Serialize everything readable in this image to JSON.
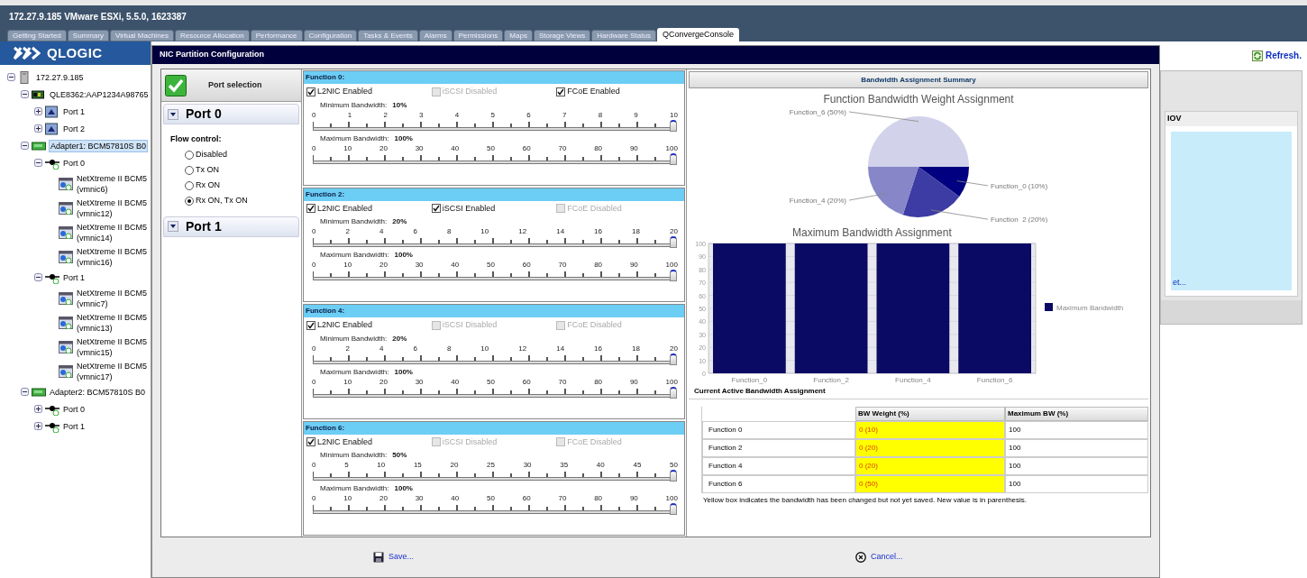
{
  "browser_title": "172.27.9.185 VMware ESXi, 5.5.0, 1623387",
  "tabs": [
    {
      "label": "Getting Started",
      "selected": false
    },
    {
      "label": "Summary",
      "selected": false
    },
    {
      "label": "Virtual Machines",
      "selected": false
    },
    {
      "label": "Resource Allocation",
      "selected": false
    },
    {
      "label": "Performance",
      "selected": false
    },
    {
      "label": "Configuration",
      "selected": false
    },
    {
      "label": "Tasks & Events",
      "selected": false
    },
    {
      "label": "Alarms",
      "selected": false
    },
    {
      "label": "Permissions",
      "selected": false
    },
    {
      "label": "Maps",
      "selected": false
    },
    {
      "label": "Storage Views",
      "selected": false
    },
    {
      "label": "Hardware Status",
      "selected": false
    },
    {
      "label": "QConvergeConsole",
      "selected": true
    }
  ],
  "logo": "QLOGIC",
  "tree": [
    {
      "label": "172.27.9.185",
      "kind": "host",
      "expanded": true,
      "selected": false,
      "children": [
        {
          "label": "QLE8362:AAP1234A98765",
          "kind": "hba",
          "expanded": true,
          "selected": false,
          "children": [
            {
              "label": "Port 1",
              "kind": "port",
              "expanded": false,
              "selected": false
            },
            {
              "label": "Port 2",
              "kind": "port",
              "expanded": false,
              "selected": false
            }
          ]
        },
        {
          "label": "Adapter1: BCM57810S B0",
          "kind": "adapter",
          "expanded": true,
          "selected": true,
          "children": [
            {
              "label": "Port 0",
              "kind": "connector",
              "expanded": true,
              "selected": false,
              "children": [
                {
                  "label": "NetXtreme II BCM5",
                  "detail": "(vmnic6)",
                  "kind": "nic",
                  "selected": false
                },
                {
                  "label": "NetXtreme II BCM5",
                  "detail": "(vmnic12)",
                  "kind": "nic",
                  "selected": false
                },
                {
                  "label": "NetXtreme II BCM5",
                  "detail": "(vmnic14)",
                  "kind": "nic",
                  "selected": false
                },
                {
                  "label": "NetXtreme II BCM5",
                  "detail": "(vmnic16)",
                  "kind": "nic",
                  "selected": false
                }
              ]
            },
            {
              "label": "Port 1",
              "kind": "connector",
              "expanded": true,
              "selected": false,
              "children": [
                {
                  "label": "NetXtreme II BCM5",
                  "detail": "(vmnic7)",
                  "kind": "nic",
                  "selected": false
                },
                {
                  "label": "NetXtreme II BCM5",
                  "detail": "(vmnic13)",
                  "kind": "nic",
                  "selected": false
                },
                {
                  "label": "NetXtreme II BCM5",
                  "detail": "(vmnic15)",
                  "kind": "nic",
                  "selected": false
                },
                {
                  "label": "NetXtreme II BCM5",
                  "detail": "(vmnic17)",
                  "kind": "nic",
                  "selected": false
                }
              ]
            }
          ]
        },
        {
          "label": "Adapter2: BCM57810S B0",
          "kind": "adapter",
          "expanded": true,
          "selected": false,
          "children": [
            {
              "label": "Port 0",
              "kind": "connector",
              "expanded": false,
              "selected": false
            },
            {
              "label": "Port 1",
              "kind": "connector",
              "expanded": false,
              "selected": false
            }
          ]
        }
      ]
    }
  ],
  "background_panel": {
    "refresh": "Refresh.",
    "header": "IOV",
    "link": "et..."
  },
  "dialog": {
    "title": "NIC Partition Configuration",
    "port_selection": {
      "title": "Port selection",
      "ports": [
        {
          "label": "Port 0",
          "flow_control": {
            "label": "Flow control:",
            "options": [
              {
                "label": "Disabled",
                "selected": false
              },
              {
                "label": "Tx ON",
                "selected": false
              },
              {
                "label": "Rx ON",
                "selected": false
              },
              {
                "label": "Rx ON, Tx ON",
                "selected": true
              }
            ]
          }
        },
        {
          "label": "Port 1"
        }
      ]
    },
    "functions": [
      {
        "title": "Function 0:",
        "options": [
          {
            "label": "L2NIC Enabled",
            "checked": true,
            "disabled": false
          },
          {
            "label": "iSCSI Disabled",
            "checked": false,
            "disabled": true
          },
          {
            "label": "FCoE Enabled",
            "checked": true,
            "disabled": false
          }
        ],
        "sliders": [
          {
            "label": "Minimum Bandwidth:",
            "value": "10%",
            "scale": [
              "0",
              "1",
              "2",
              "3",
              "4",
              "5",
              "6",
              "7",
              "8",
              "9",
              "10"
            ],
            "level": 1
          },
          {
            "label": "Maximum Bandwidth:",
            "value": "100%",
            "scale": [
              "0",
              "10",
              "20",
              "30",
              "40",
              "50",
              "60",
              "70",
              "80",
              "90",
              "100"
            ],
            "level": 1
          }
        ]
      },
      {
        "title": "Function 2:",
        "options": [
          {
            "label": "L2NIC Enabled",
            "checked": true,
            "disabled": false
          },
          {
            "label": "iSCSI Enabled",
            "checked": true,
            "disabled": false
          },
          {
            "label": "FCoE Disabled",
            "checked": false,
            "disabled": true
          }
        ],
        "sliders": [
          {
            "label": "Minimum Bandwidth:",
            "value": "20%",
            "scale": [
              "0",
              "2",
              "4",
              "6",
              "8",
              "10",
              "12",
              "14",
              "16",
              "18",
              "20"
            ],
            "level": 1
          },
          {
            "label": "Maximum Bandwidth:",
            "value": "100%",
            "scale": [
              "0",
              "10",
              "20",
              "30",
              "40",
              "50",
              "60",
              "70",
              "80",
              "90",
              "100"
            ],
            "level": 1
          }
        ]
      },
      {
        "title": "Function 4:",
        "options": [
          {
            "label": "L2NIC Enabled",
            "checked": true,
            "disabled": false
          },
          {
            "label": "iSCSI Disabled",
            "checked": false,
            "disabled": true
          },
          {
            "label": "FCoE Disabled",
            "checked": false,
            "disabled": true
          }
        ],
        "sliders": [
          {
            "label": "Minimum Bandwidth:",
            "value": "20%",
            "scale": [
              "0",
              "2",
              "4",
              "6",
              "8",
              "10",
              "12",
              "14",
              "16",
              "18",
              "20"
            ],
            "level": 1
          },
          {
            "label": "Maximum Bandwidth:",
            "value": "100%",
            "scale": [
              "0",
              "10",
              "20",
              "30",
              "40",
              "50",
              "60",
              "70",
              "80",
              "90",
              "100"
            ],
            "level": 1
          }
        ]
      },
      {
        "title": "Function 6:",
        "options": [
          {
            "label": "L2NIC Enabled",
            "checked": true,
            "disabled": false
          },
          {
            "label": "iSCSI Disabled",
            "checked": false,
            "disabled": true
          },
          {
            "label": "FCoE Disabled",
            "checked": false,
            "disabled": true
          }
        ],
        "sliders": [
          {
            "label": "Minimum Bandwidth:",
            "value": "50%",
            "scale": [
              "0",
              "5",
              "10",
              "15",
              "20",
              "25",
              "30",
              "35",
              "40",
              "45",
              "50"
            ],
            "level": 1
          },
          {
            "label": "Maximum Bandwidth:",
            "value": "100%",
            "scale": [
              "0",
              "10",
              "20",
              "30",
              "40",
              "50",
              "60",
              "70",
              "80",
              "90",
              "100"
            ],
            "level": 1
          }
        ]
      }
    ],
    "summary": {
      "title": "Bandwidth Assignment Summary",
      "pie_chart": {
        "chart_data": {
          "type": "pie",
          "title": "Function Bandwidth Weight Assignment",
          "categories": [
            "Function_0 (10%)",
            "Function_2 (20%)",
            "Function_4 (20%)",
            "Function_6 (50%)"
          ],
          "values": [
            10,
            20,
            20,
            50
          ],
          "colors": [
            "#000080",
            "#3c3ca4",
            "#8686c8",
            "#d2d2ea"
          ]
        }
      },
      "bar_chart": {
        "chart_data": {
          "type": "bar",
          "title": "Maximum Bandwidth Assignment",
          "categories": [
            "Function_0",
            "Function_2",
            "Function_4",
            "Function_6"
          ],
          "series": [
            {
              "name": "Maximum Bandwidth",
              "color": "#0a0a64",
              "values": [
                100,
                100,
                100,
                100
              ]
            }
          ],
          "grid": true,
          "ylim": [
            0,
            100
          ],
          "yticks": [
            0,
            10,
            20,
            30,
            40,
            50,
            60,
            70,
            80,
            90,
            100
          ]
        }
      },
      "table": {
        "title": "Current Active Bandwidth Assignment",
        "columns": [
          "BW Weight (%)",
          "Maximum BW (%)"
        ],
        "rows": [
          {
            "label": "Function 0",
            "bw_weight": "0 (10)",
            "max_bw": "100",
            "changed": true
          },
          {
            "label": "Function 2",
            "bw_weight": "0 (20)",
            "max_bw": "100",
            "changed": true
          },
          {
            "label": "Function 4",
            "bw_weight": "0 (20)",
            "max_bw": "100",
            "changed": true
          },
          {
            "label": "Function 6",
            "bw_weight": "0 (50)",
            "max_bw": "100",
            "changed": true
          }
        ]
      },
      "note": "Yellow box indicates the bandwidth has been changed but not yet saved. New value is in parenthesis."
    },
    "buttons": [
      {
        "label": "Save...",
        "kind": "save"
      },
      {
        "label": "Cancel...",
        "kind": "cancel"
      }
    ]
  }
}
